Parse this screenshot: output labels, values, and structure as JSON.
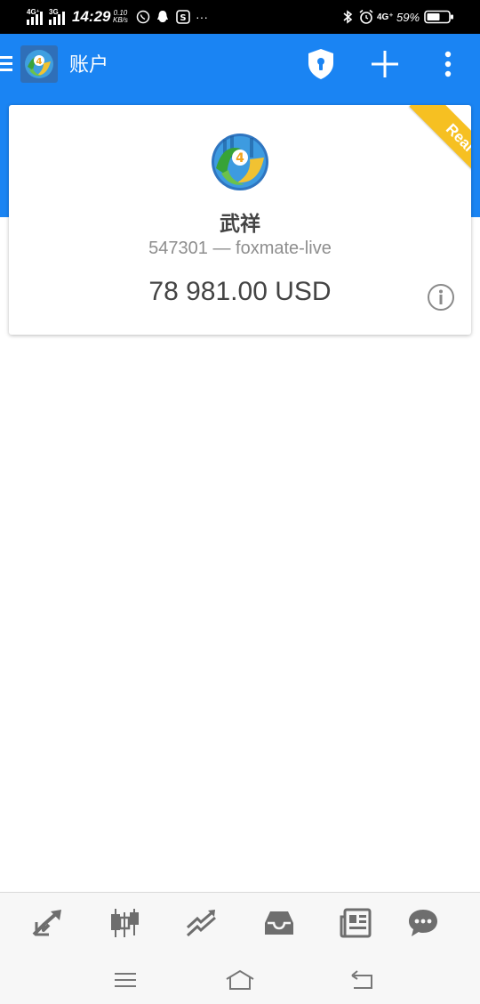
{
  "status_bar": {
    "network_left_1": "4G⁺",
    "network_left_2": "3G",
    "time": "14:29",
    "speed_value": "0.10",
    "speed_unit": "KB/s",
    "network_right": "4G⁺",
    "battery_percent": "59%",
    "more": "···"
  },
  "app_bar": {
    "title": "账户",
    "icons": [
      "menu-icon",
      "mt4-logo",
      "shield-lock-icon",
      "add-icon",
      "overflow-menu-icon"
    ]
  },
  "account": {
    "badge": "Real",
    "name": "武祥",
    "server_line": "547301 — foxmate-live",
    "balance": "78 981.00 USD"
  },
  "bottom_nav": {
    "items": [
      "quotes-icon",
      "chart-icon",
      "trade-icon",
      "history-icon",
      "news-icon",
      "chat-icon"
    ]
  },
  "system_nav": {
    "items": [
      "recent-apps",
      "home",
      "back"
    ]
  },
  "colors": {
    "primary": "#1a84f3",
    "ribbon": "#f6c022",
    "icon_gray": "#6e6e6e"
  }
}
